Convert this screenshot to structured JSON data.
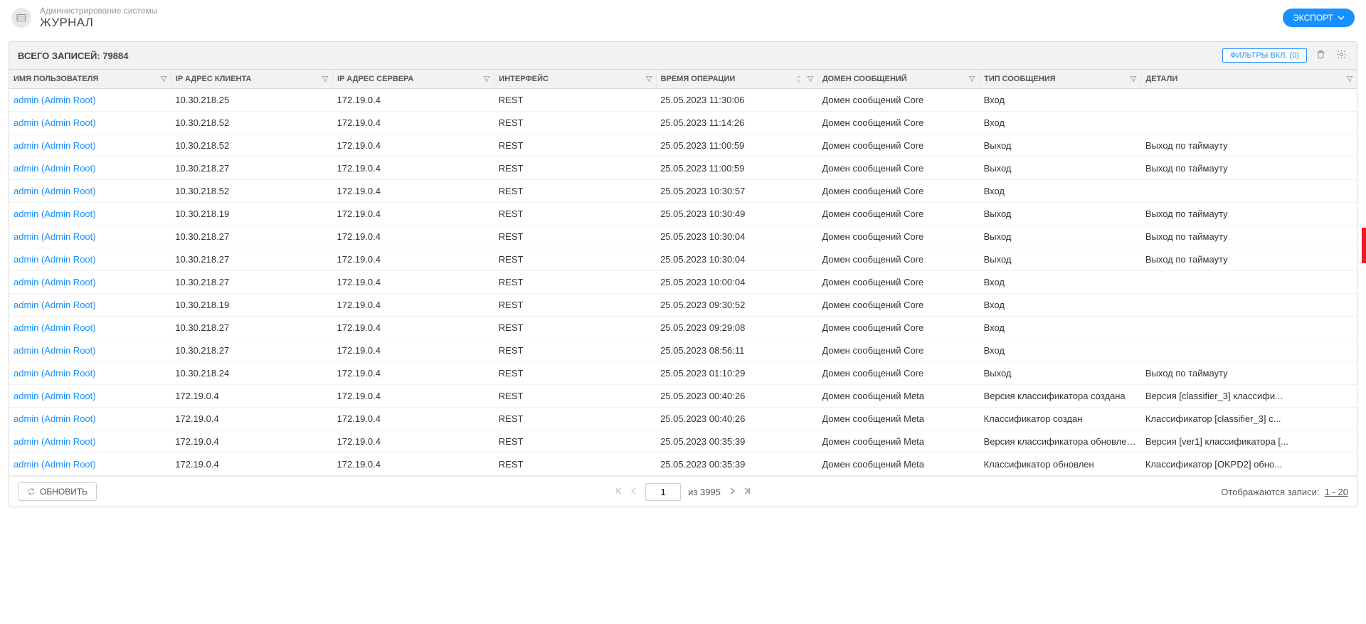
{
  "header": {
    "breadcrumb": "Администрирование системы",
    "title": "ЖУРНАЛ",
    "export_label": "ЭКСПОРТ"
  },
  "panel": {
    "total_label": "ВСЕГО ЗАПИСЕЙ:",
    "total_count": "79884",
    "filter_button": "ФИЛЬТРЫ ВКЛ. (0)"
  },
  "columns": [
    "ИМЯ ПОЛЬЗОВАТЕЛЯ",
    "IP АДРЕС КЛИЕНТА",
    "IP АДРЕС СЕРВЕРА",
    "ИНТЕРФЕЙС",
    "ВРЕМЯ ОПЕРАЦИИ",
    "ДОМЕН СООБЩЕНИЙ",
    "ТИП СООБЩЕНИЯ",
    "ДЕТАЛИ"
  ],
  "rows": [
    {
      "user": "admin (Admin  Root)",
      "client": "10.30.218.25",
      "server": "172.19.0.4",
      "iface": "REST",
      "time": "25.05.2023 11:30:06",
      "domain": "Домен сообщений Core",
      "msgtype": "Вход",
      "details": ""
    },
    {
      "user": "admin (Admin  Root)",
      "client": "10.30.218.52",
      "server": "172.19.0.4",
      "iface": "REST",
      "time": "25.05.2023 11:14:26",
      "domain": "Домен сообщений Core",
      "msgtype": "Вход",
      "details": ""
    },
    {
      "user": "admin (Admin  Root)",
      "client": "10.30.218.52",
      "server": "172.19.0.4",
      "iface": "REST",
      "time": "25.05.2023 11:00:59",
      "domain": "Домен сообщений Core",
      "msgtype": "Выход",
      "details": "Выход по таймауту"
    },
    {
      "user": "admin (Admin  Root)",
      "client": "10.30.218.27",
      "server": "172.19.0.4",
      "iface": "REST",
      "time": "25.05.2023 11:00:59",
      "domain": "Домен сообщений Core",
      "msgtype": "Выход",
      "details": "Выход по таймауту"
    },
    {
      "user": "admin (Admin  Root)",
      "client": "10.30.218.52",
      "server": "172.19.0.4",
      "iface": "REST",
      "time": "25.05.2023 10:30:57",
      "domain": "Домен сообщений Core",
      "msgtype": "Вход",
      "details": ""
    },
    {
      "user": "admin (Admin  Root)",
      "client": "10.30.218.19",
      "server": "172.19.0.4",
      "iface": "REST",
      "time": "25.05.2023 10:30:49",
      "domain": "Домен сообщений Core",
      "msgtype": "Выход",
      "details": "Выход по таймауту"
    },
    {
      "user": "admin (Admin  Root)",
      "client": "10.30.218.27",
      "server": "172.19.0.4",
      "iface": "REST",
      "time": "25.05.2023 10:30:04",
      "domain": "Домен сообщений Core",
      "msgtype": "Выход",
      "details": "Выход по таймауту"
    },
    {
      "user": "admin (Admin  Root)",
      "client": "10.30.218.27",
      "server": "172.19.0.4",
      "iface": "REST",
      "time": "25.05.2023 10:30:04",
      "domain": "Домен сообщений Core",
      "msgtype": "Выход",
      "details": "Выход по таймауту"
    },
    {
      "user": "admin (Admin  Root)",
      "client": "10.30.218.27",
      "server": "172.19.0.4",
      "iface": "REST",
      "time": "25.05.2023 10:00:04",
      "domain": "Домен сообщений Core",
      "msgtype": "Вход",
      "details": ""
    },
    {
      "user": "admin (Admin  Root)",
      "client": "10.30.218.19",
      "server": "172.19.0.4",
      "iface": "REST",
      "time": "25.05.2023 09:30:52",
      "domain": "Домен сообщений Core",
      "msgtype": "Вход",
      "details": ""
    },
    {
      "user": "admin (Admin  Root)",
      "client": "10.30.218.27",
      "server": "172.19.0.4",
      "iface": "REST",
      "time": "25.05.2023 09:29:08",
      "domain": "Домен сообщений Core",
      "msgtype": "Вход",
      "details": ""
    },
    {
      "user": "admin (Admin  Root)",
      "client": "10.30.218.27",
      "server": "172.19.0.4",
      "iface": "REST",
      "time": "25.05.2023 08:56:11",
      "domain": "Домен сообщений Core",
      "msgtype": "Вход",
      "details": ""
    },
    {
      "user": "admin (Admin  Root)",
      "client": "10.30.218.24",
      "server": "172.19.0.4",
      "iface": "REST",
      "time": "25.05.2023 01:10:29",
      "domain": "Домен сообщений Core",
      "msgtype": "Выход",
      "details": "Выход по таймауту"
    },
    {
      "user": "admin (Admin  Root)",
      "client": "172.19.0.4",
      "server": "172.19.0.4",
      "iface": "REST",
      "time": "25.05.2023 00:40:26",
      "domain": "Домен сообщений Meta",
      "msgtype": "Версия классификатора создана",
      "details": "Версия [classifier_3] классифи..."
    },
    {
      "user": "admin (Admin  Root)",
      "client": "172.19.0.4",
      "server": "172.19.0.4",
      "iface": "REST",
      "time": "25.05.2023 00:40:26",
      "domain": "Домен сообщений Meta",
      "msgtype": "Классификатор создан",
      "details": "Классификатор [classifier_3] с..."
    },
    {
      "user": "admin (Admin  Root)",
      "client": "172.19.0.4",
      "server": "172.19.0.4",
      "iface": "REST",
      "time": "25.05.2023 00:35:39",
      "domain": "Домен сообщений Meta",
      "msgtype": "Версия классификатора обновлена",
      "details": "Версия [ver1] классификатора [..."
    },
    {
      "user": "admin (Admin  Root)",
      "client": "172.19.0.4",
      "server": "172.19.0.4",
      "iface": "REST",
      "time": "25.05.2023 00:35:39",
      "domain": "Домен сообщений Meta",
      "msgtype": "Классификатор обновлен",
      "details": "Классификатор [OKPD2] обно..."
    }
  ],
  "footer": {
    "refresh_label": "ОБНОВИТЬ",
    "page_current": "1",
    "page_of_label": "из",
    "page_total": "3995",
    "display_label": "Отображаются записи:",
    "display_range": "1 - 20"
  }
}
